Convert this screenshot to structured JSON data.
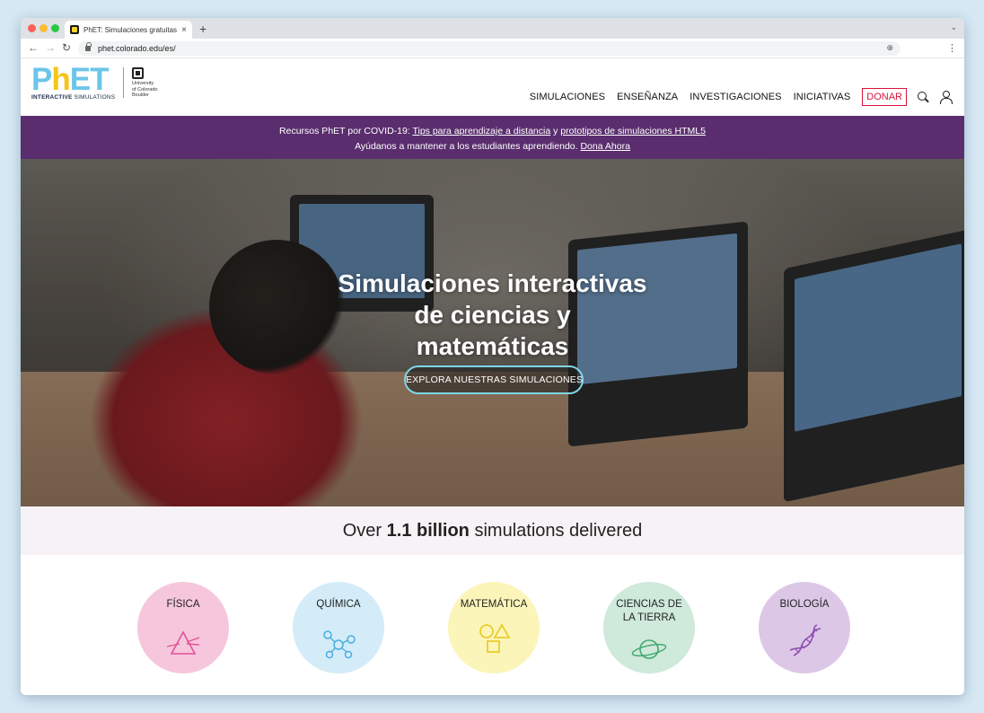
{
  "browser": {
    "tab_title": "PhET: Simulaciones gratuitas e",
    "tab_close": "×",
    "new_tab": "+",
    "url": "phet.colorado.edu/es/"
  },
  "site": {
    "logo": {
      "p": "P",
      "h": "h",
      "et": "ET",
      "sub_bold": "INTERACTIVE",
      "sub_rest": " SIMULATIONS",
      "university": [
        "University",
        "of Colorado",
        "Boulder"
      ]
    },
    "nav": [
      "SIMULACIONES",
      "ENSEÑANZA",
      "INVESTIGACIONES",
      "INICIATIVAS"
    ],
    "donate": "DONAR"
  },
  "banner": {
    "line1_prefix": "Recursos PhET por COVID-19: ",
    "line1_link1": "Tips para aprendizaje a distancia",
    "line1_mid": " y ",
    "line1_link2": "prototipos de simulaciones HTML5",
    "line2_prefix": "Ayúdanos a mantener a los estudiantes aprendiendo. ",
    "line2_link": "Dona Ahora",
    "bg_color": "#5a2e6e"
  },
  "hero": {
    "title_lines": [
      "Simulaciones interactivas",
      "de ciencias y",
      "matemáticas"
    ],
    "cta": "EXPLORA NUESTRAS SIMULACIONES"
  },
  "stats": {
    "prefix": "Over ",
    "value": "1.1 billion",
    "suffix": " simulations delivered"
  },
  "categories": [
    {
      "label": "FÍSICA",
      "icon": "prism-icon",
      "color": "#f6c7dc",
      "icon_color": "#e0529a"
    },
    {
      "label": "QUÍMICA",
      "icon": "molecule-icon",
      "color": "#d3ecf8",
      "icon_color": "#49aee0"
    },
    {
      "label": "MATEMÁTICA",
      "icon": "shapes-icon",
      "color": "#fbf5b9",
      "icon_color": "#e8c81a"
    },
    {
      "label": "CIENCIAS DE LA TIERRA",
      "label_lines": [
        "CIENCIAS DE",
        "LA TIERRA"
      ],
      "icon": "planet-icon",
      "color": "#cfe9db",
      "icon_color": "#3fa86f"
    },
    {
      "label": "BIOLOGÍA",
      "icon": "dna-icon",
      "color": "#dcc8e6",
      "icon_color": "#8f4fb0"
    }
  ]
}
